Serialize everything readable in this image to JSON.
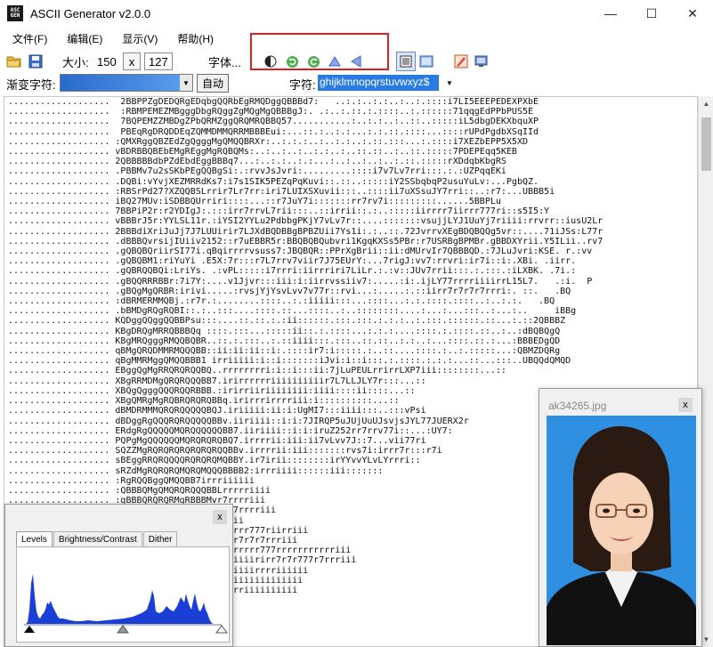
{
  "app": {
    "title": "ASCII Generator v2.0.0",
    "logo_top": "ASC",
    "logo_bottom": "GEN"
  },
  "window_controls": {
    "minimize": "—",
    "maximize": "☐",
    "close": "✕"
  },
  "menu": [
    {
      "label": "文件(F)"
    },
    {
      "label": "编辑(E)"
    },
    {
      "label": "显示(V)"
    },
    {
      "label": "帮助(H)"
    }
  ],
  "toolbar": {
    "size_label": "大小:",
    "width_value": "150",
    "x_label": "x",
    "height_value": "127",
    "font_label": "字体...",
    "gradient_label": "渐变字符:",
    "auto_label": "自动",
    "chars_label": "字符:",
    "chars_value": "ghijklmnopqrstuvwxyz$"
  },
  "ascii_lines": [
    "...................  2BBPPZgDEDQRgEDqbgQQRbEgRMQDggQBBBd7:   ..:.:..:.:..:..:.::::i7LI5EEEPEDEXPXbE",
    "...................  :RBMPEMEZMBgggDbgRQggZgMQgMgQBBBgJ:. .:..:.::.:.::::..:.::::::71qqgEdPPbPUS5E",
    "...................  7BQPEMZZMBDgZPbQRMZggQRQMRQBBQ57...........:..:.:..:..::..:::::iL5dbgDEKXbquXP",
    "...................  PBEqRgDRQDDEqZQMMDMMQRRMBBBEui:...::.:..:.:...:.:.::.::::...::::rUPdPgdbXSqIId",
    "................... :QMXRggQBZEdZgQgggMgQMQQBRXr:..:.:.:..:..:.:..:.::.:::...:.::::i7XEZbEPP5X5XD",
    "................... vBDRBBQBEbEMgREggMgRQBQMs:..:..:..:..:.:..:..::.::..:..::.:::::7PDEPEqq5KEB",
    "................... 2QBBBBBdbPZdEbdEggBBBq7...:..:.:..:.:...:..:..:..:..:.::.:::::rXDdqbKbgRS",
    "................... .PBBMv7u2sSKbPEgQQBgSi:.:rvvJsJvri:.........::::i7v7Lv7rri:::.:.:UZPqqEKi",
    "................... .DQBi:vYvjXEZMRRdKs7:i7s1SIK5PEZqPqKuvi::.::..:::::iY2SSbqbqP2usuYuLv:...PgbQZ.",
    "................... :RBSrPd27?XZQQBSLrrir7Lr7rr:iri7LUIXSXuvii:::..::::ii7uXSsuJY7rri::..:r7:...UBBB5i",
    "................... iBQ27MUv:iSDBBQUrriri::::...::r7JuY7i:::::::rr7rv7i:::::::::......5BBPLu",
    "................... 7BBPiP2r:r2YDIgJ:.:::irr7rrvL7rii:::..::irrii::.:..:::::iirrrr7iirrr777ri::s5I5:Y",
    "................... vBBBrJ5r:YYLSL11r.:iYSI2YYLu2PdbbgPKjY7vLv7r::....:::::::vsujjLYJ1UuYj7riiii:rrvrr::iusU2Lr",
    "................... 2BBBdiXriJuJj7J7LUUirir7LJXdBQDBBgBPBZUii7Ys1i:.:..::.72JvrrvXEgBDQBQQg5vr::....71iJSs:L77r",
    "................... .dBBBQvrsijIUiiv2152::r7uEBBR5r:BBQBQBQubvri1KgqKXSs5PBr:r7USRBgBPMBr.gBBDXYrii.Y5ILii..rv7",
    "................... .gQBQBQriirSI77i.qBqirrrrvsuss7:JBQBQR::PPrXgBrii::ii:dMUrvIr7QBBBQD.:7JLuJvri:KSE. r.:vv",
    "................... .gQBQBM1:riYuYi .E5X:7r:::r7L7rrv7viir7J75EUrY:...7rigJ:vv7:rrvri:ir7i::i:.XBi. .iirr.",
    "................... .gQBRQQBQi:LriYs. .:vPL:::::i7rrri:iirrriri7LiLr.:.:v::JUv7rrii:::.:.:::.:iLXBK. .7i.:",
    "................... .gBQQRRRBBr:7i7Y:....v1Jjvr:::iii:i:iirrvssiiv7:.....:i:.ijLY77rrrriiiirrL15L7.   .:i.  P",
    "................... .gBQgMgQRBR:irivi.....:rvsjYjYsvLvv7v77r::rvi...:.....:.::iirr7r7r7r7rrri:. ::.   .BQ",
    "................... :dBRMERMMQBj.:r7r.:........::::..:.:iiiii:::...::::...:.:.::::.::::..:..:.:.   .BQ",
    "................... .bBMDgRQgRQBI::.:..:::....::::.::...::::..:..::::::::....:...:...:::..:...:..     iBBg",
    "................... KQDggQQggQQBBPsu:::....::.::.:.:ii::::::.:::.:::.:.:.:..:.:::.::::::.::...:.::2QBBBZ",
    "................... KBgDRQgMRRQBBBQq ::::.:::...:::::ii::.:.::::...:.:.:....::::.:.::::.::..:..:dBQBQgQ",
    "................... KBgMRQgggRMQQBQBR..::.:.:::..:.::iiii:::.:::..::.::..:.:..:...::::.::.:...:BBBEDgQD",
    "................... qBMgQRQDMMRMQQQBB::ii:ii:ii::i:.::::ir7:i:::::.:..::....::::.:..:.:::::...:QBMZDQRg",
    "................... qBgMMRMggQMQQBBB1 irriiiii:i::i:::::::iJvi:i::i:::.:.::::.:.:.:...::...:::..UBQQdQMQD",
    "................... EBggQgMgRRQRQRQQBQ..rrrrrrrri:i::i:::ii:7jLuPEULrrirrLXP7iii::::::::...::",
    "................... XBgRRMDMgQRQRQQQBB7.irirrrrrriiiiiiiiiir7L7LLJLY7r:::...::",
    "................... XBQgQgggQQQRQQRBBB.:irirriiriiiiiiii:iiii::::ii::::...::",
    "................... XBgQMRgMgRQBRQRQRQBBq.irirrrirrrriii:i::::::::::...::",
    "................... dBMDRMMMQRQRQQQQQBQJ.iriiiii:ii:i:UgMI7:::iiii:::..:::vPsi",
    "................... dBDggRgQQQRQRQQQQQBBv.iiriiii::i:i:7JIRQP5uJUjUuUJsvjsJYL77JUERX2r",
    "................... ERdgRgQQQQQMQRQQQQQQBB7.iiriiii::i:i:iruZ252rr7rrv77i::...:UY7:",
    "................... PQPgMgQQQQQQMQRQRQRQBQ7.irrrrii:iii:ii7vLvv7J::7...vii77ri",
    "................... SQZZMgRQRQRQRQRQRQRQQBBv.irrrrii:iii:::::::rvs7i:irrr7r:::r7i",
    "................... sBEggRRQRQQQQRQRQRQMQBBY.ir7irii::::::::irYYvvYLvLYrrri::",
    "................... sRZdMgRQRQRQMQRQMQQQBBBB2:irrriiii::::::iii:::::::",
    "................... :RgRQQBggQMQQBB7irrriiiiii",
    "................... :QBBBQMgQMQRQRQQQBBLrrrrriiii",
    "................... :gBBBQRQRQRMgRBBBMvr7rrrriii",
    "................... :QQMQQQQMQRMQQgQBQv.:r7rrrriii",
    "................... :QQQMQQBBBs s77r7rrriiii",
    "................... :QBgRQRRRRQQQQB..:j7rrrrr777riirriii",
    "................... :gQRQMQBREBB  .S7rrrrrr7r7r7rrriii",
    "................... :QQRQRMPMBB  .Svrrirrrrrrrr777rrrrrrrrrrriii",
    "................... :gQQgQMgdDRB5  Lurirriiiiirirr7r7r777r7rrriii",
    "................... :gQQgDDgQBP   .S7riiiiiiiirrrriiiiii",
    "................... :gQQgRgZgMBB   rS77iiiiiiiiiiiiiiii",
    "................... :QQgDgDQBB:    iI7rrrrrriiiiiiiiii"
  ],
  "levels_window": {
    "tabs": [
      "Levels",
      "Brightness/Contrast",
      "Dither"
    ],
    "close": "x"
  },
  "preview_window": {
    "title": "ak34265.jpg",
    "close": "x"
  },
  "icons": {
    "open": "folder-open-icon",
    "save": "save-icon",
    "invert": "invert-icon",
    "rotate_cw": "rotate-cw-icon",
    "rotate_ccw": "rotate-ccw-icon",
    "flip_vertical": "flip-vertical-icon",
    "flip_horizontal": "flip-horizontal-icon"
  },
  "colors": {
    "highlight_box": "#e02020",
    "selection": "#2a7be0",
    "histogram": "#1a3fd6",
    "photo_bg": "#2f8fe0"
  }
}
